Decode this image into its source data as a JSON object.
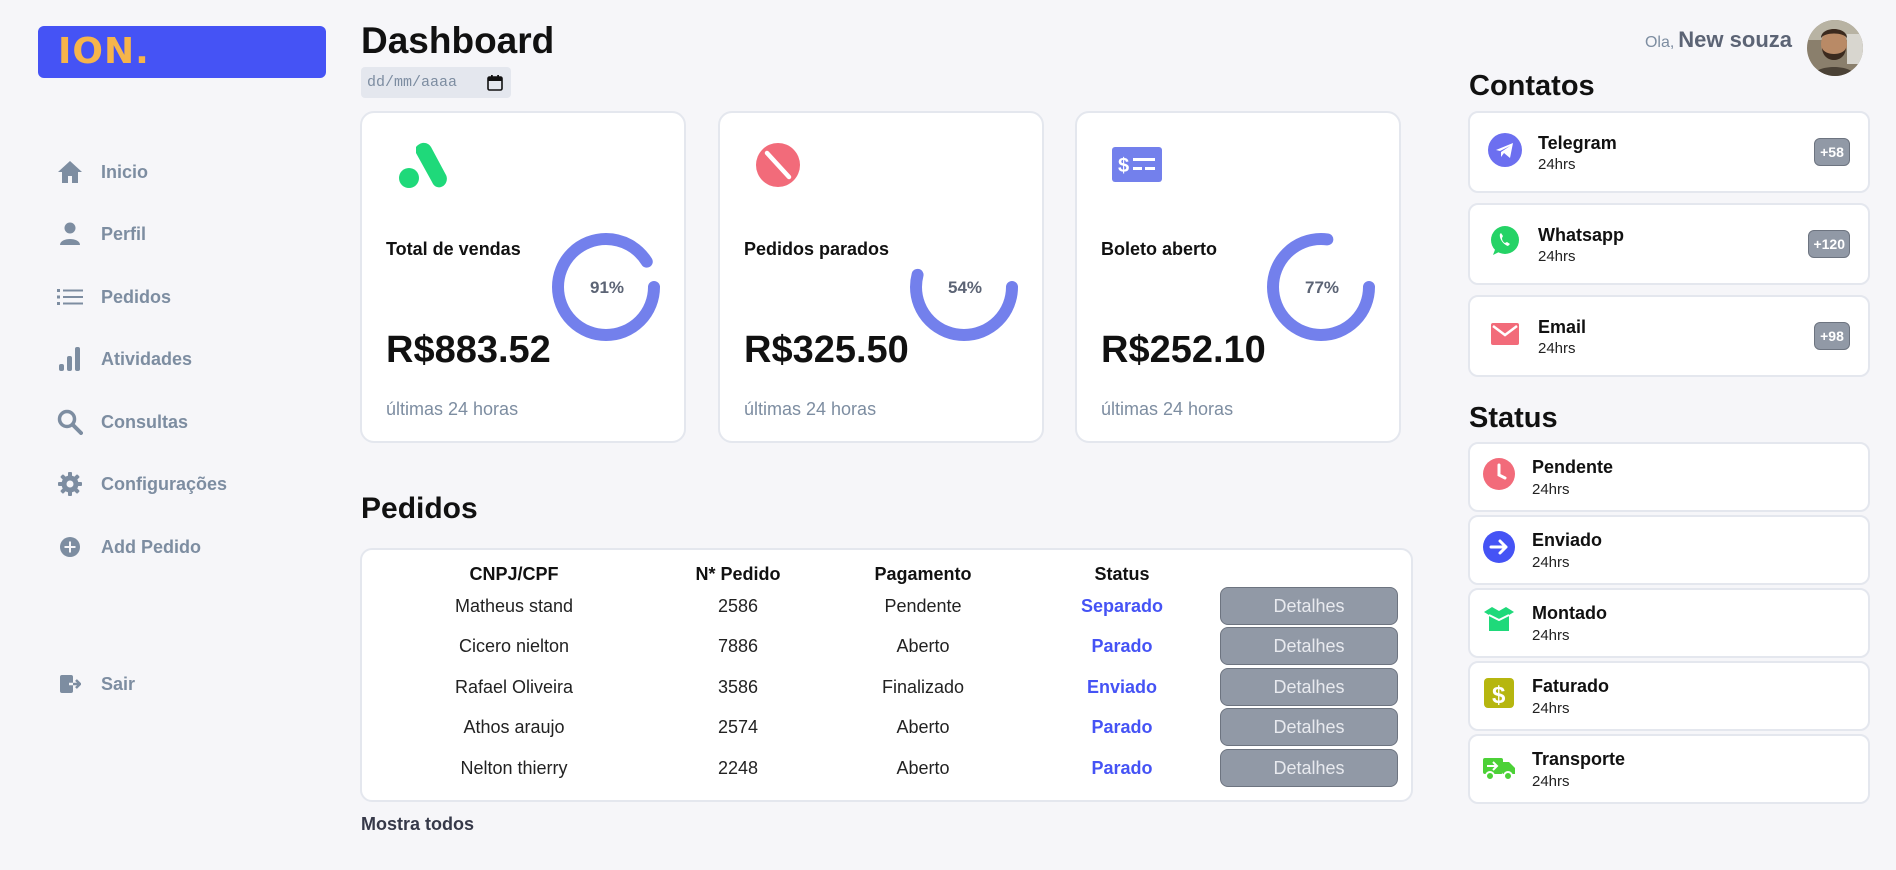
{
  "app": {
    "logo": "ION."
  },
  "sidebar": {
    "items": [
      {
        "label": "Inicio"
      },
      {
        "label": "Perfil"
      },
      {
        "label": "Pedidos"
      },
      {
        "label": "Atividades"
      },
      {
        "label": "Consultas"
      },
      {
        "label": "Configurações"
      },
      {
        "label": "Add Pedido"
      }
    ],
    "logout": "Sair"
  },
  "header": {
    "title": "Dashboard",
    "date_placeholder": "dd/mm/aaaa",
    "greeting": "Ola,",
    "user_name": "New souza"
  },
  "cards": [
    {
      "title": "Total de vendas",
      "value": "R$883.52",
      "percent": "91%",
      "percent_value": 91,
      "subtitle": "últimas 24 horas"
    },
    {
      "title": "Pedidos parados",
      "value": "R$325.50",
      "percent": "54%",
      "percent_value": 54,
      "subtitle": "últimas 24 horas"
    },
    {
      "title": "Boleto aberto",
      "value": "R$252.10",
      "percent": "77%",
      "percent_value": 77,
      "subtitle": "últimas 24 horas"
    }
  ],
  "orders": {
    "title": "Pedidos",
    "columns": [
      "CNPJ/CPF",
      "N* Pedido",
      "Pagamento",
      "Status"
    ],
    "rows": [
      {
        "client": "Matheus stand",
        "number": "2586",
        "payment": "Pendente",
        "status": "Separado",
        "action": "Detalhes"
      },
      {
        "client": "Cicero nielton",
        "number": "7886",
        "payment": "Aberto",
        "status": "Parado",
        "action": "Detalhes"
      },
      {
        "client": "Rafael Oliveira",
        "number": "3586",
        "payment": "Finalizado",
        "status": "Enviado",
        "action": "Detalhes"
      },
      {
        "client": "Athos araujo",
        "number": "2574",
        "payment": "Aberto",
        "status": "Parado",
        "action": "Detalhes"
      },
      {
        "client": "Nelton thierry",
        "number": "2248",
        "payment": "Aberto",
        "status": "Parado",
        "action": "Detalhes"
      }
    ],
    "show_all": "Mostra todos"
  },
  "contacts": {
    "title": "Contatos",
    "items": [
      {
        "name": "Telegram",
        "time": "24hrs",
        "badge": "+58",
        "icon": "telegram-icon",
        "color": "#6c6ff0"
      },
      {
        "name": "Whatsapp",
        "time": "24hrs",
        "badge": "+120",
        "icon": "whatsapp-icon",
        "color": "#25d366"
      },
      {
        "name": "Email",
        "time": "24hrs",
        "badge": "+98",
        "icon": "email-icon",
        "color": "#f26b7a"
      }
    ]
  },
  "status": {
    "title": "Status",
    "items": [
      {
        "name": "Pendente",
        "time": "24hrs",
        "icon": "clock-icon",
        "color": "#f26b7a"
      },
      {
        "name": "Enviado",
        "time": "24hrs",
        "icon": "arrow-right-icon",
        "color": "#4553f5"
      },
      {
        "name": "Montado",
        "time": "24hrs",
        "icon": "box-icon",
        "color": "#1fd97a"
      },
      {
        "name": "Faturado",
        "time": "24hrs",
        "icon": "dollar-icon",
        "color": "#b6b60f"
      },
      {
        "name": "Transporte",
        "time": "24hrs",
        "icon": "truck-icon",
        "color": "#4cd137"
      }
    ]
  },
  "colors": {
    "accent": "#4553f5",
    "ring": "#7380ec",
    "logo_text": "#f6b44b"
  }
}
